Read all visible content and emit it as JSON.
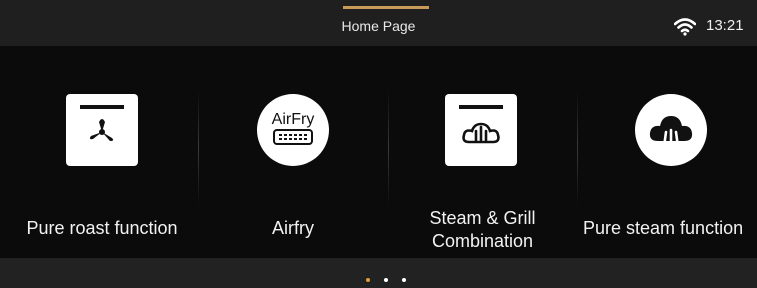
{
  "status_bar": {
    "title": "Home Page",
    "time": "13:21",
    "wifi_icon": "wifi-icon",
    "accent_color": "#c89a5a"
  },
  "cards": [
    {
      "label": "Pure roast function",
      "icon": "fan-icon"
    },
    {
      "label": "Airfry",
      "icon_text": "AirFry",
      "icon": "airfry-icon"
    },
    {
      "label_line1": "Steam & Grill",
      "label_line2": "Combination",
      "icon": "steam-grill-icon"
    },
    {
      "label": "Pure steam function",
      "icon": "steam-cloud-icon"
    }
  ],
  "pager": {
    "pages": 3,
    "active_page": 1,
    "active_color": "#e0a030",
    "inactive_color": "#ffffff"
  }
}
